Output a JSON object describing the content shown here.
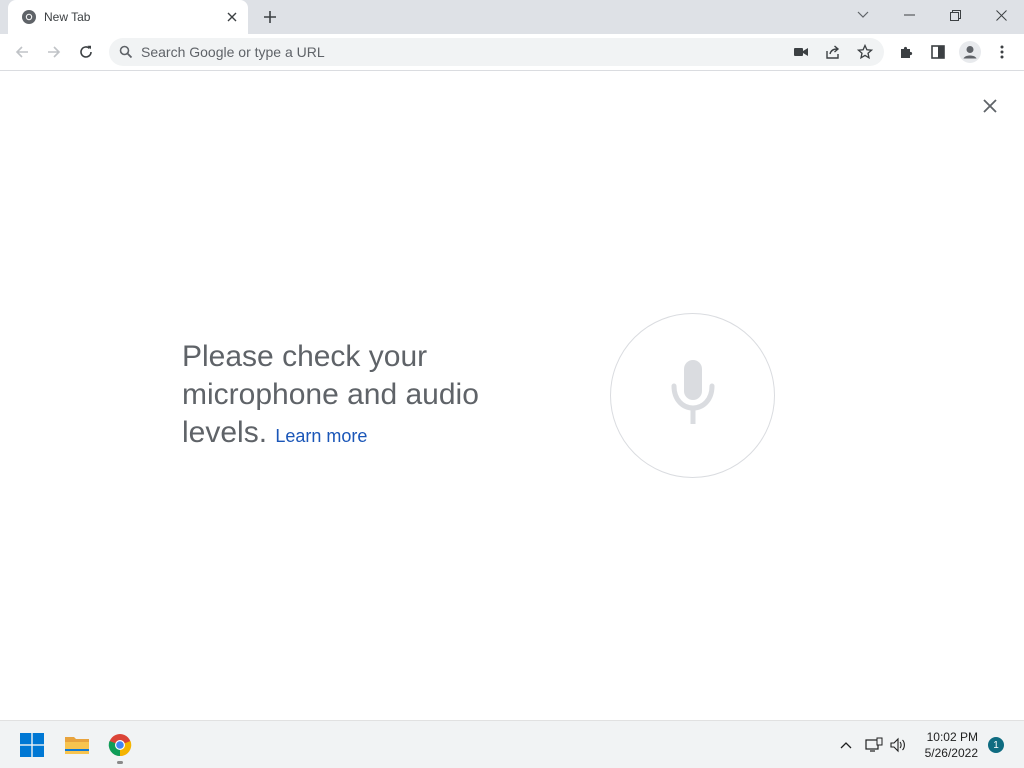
{
  "browser": {
    "tab": {
      "title": "New Tab"
    },
    "omnibox": {
      "placeholder": "Search Google or type a URL",
      "value": ""
    }
  },
  "voice_search": {
    "message": "Please check your microphone and audio levels.",
    "link_label": "Learn more"
  },
  "taskbar": {
    "time": "10:02 PM",
    "date": "5/26/2022",
    "notification_count": "1"
  },
  "icons": {
    "tab": [
      "chrome-favicon-icon",
      "close-icon",
      "plus-icon"
    ],
    "window": [
      "chevron-down-icon",
      "minimize-icon",
      "restore-icon",
      "close-icon"
    ],
    "toolbar": [
      "back-arrow-icon",
      "forward-arrow-icon",
      "reload-icon",
      "search-icon",
      "video-camera-icon",
      "share-icon",
      "star-icon",
      "puzzle-icon",
      "side-panel-icon",
      "profile-icon",
      "more-vert-icon"
    ],
    "content": [
      "close-icon",
      "microphone-icon"
    ],
    "taskbar": [
      "windows-start-icon",
      "folder-icon",
      "chrome-icon",
      "chevron-up-icon",
      "network-icon",
      "speaker-icon"
    ]
  },
  "colors": {
    "tab_strip": "#dee1e6",
    "omnibox": "#f1f3f4",
    "message_text": "#5f6368",
    "link": "#1a56b8",
    "mic": "#dadce0",
    "windows_blue": "#0078d4",
    "badge": "#0f6c81"
  }
}
